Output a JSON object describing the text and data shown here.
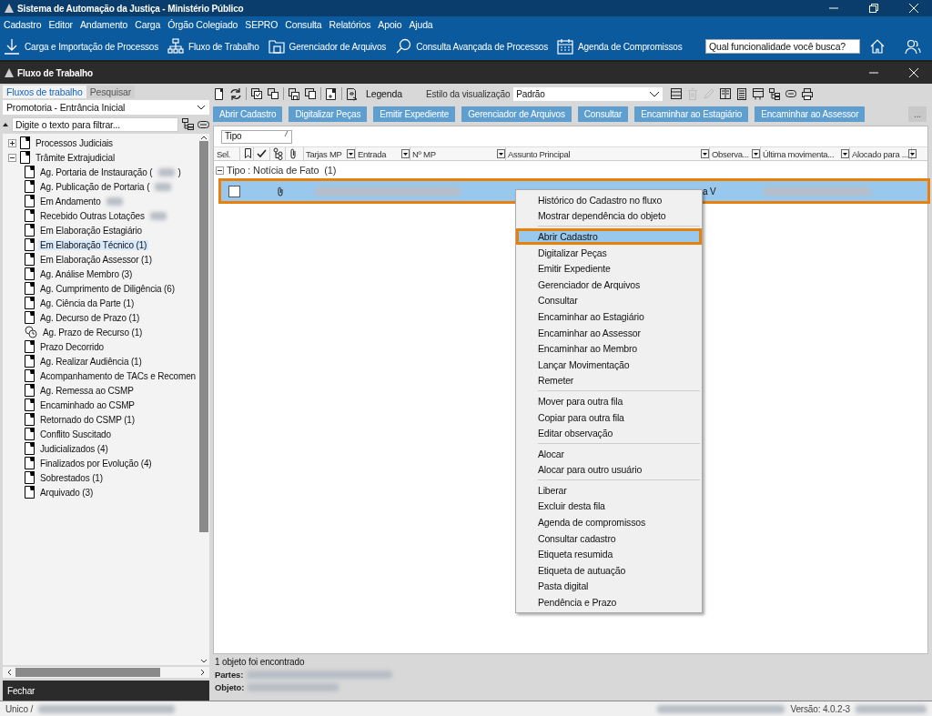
{
  "window": {
    "title": "Sistema de Automação da Justiça - Ministério Público"
  },
  "menu": [
    "Cadastro",
    "Editor",
    "Andamento",
    "Carga",
    "Órgão Colegiado",
    "SEPRO",
    "Consulta",
    "Relatórios",
    "Apoio",
    "Ajuda"
  ],
  "toolbar": [
    "Carga e Importação de Processos",
    "Fluxo de Trabalho",
    "Gerenciador de Arquivos",
    "Consulta Avançada de Processos",
    "Agenda de Compromissos"
  ],
  "search": {
    "placeholder": "Qual funcionalidade você busca?"
  },
  "subwindow": {
    "title": "Fluxo de Trabalho"
  },
  "left_tabs": [
    {
      "label": "Fluxos de trabalho",
      "selected": true
    },
    {
      "label": "Pesquisar",
      "selected": false
    }
  ],
  "flow_select": {
    "value": "Promotoria - Entrância Inicial"
  },
  "filter": {
    "placeholder": "Digite o texto para filtrar..."
  },
  "tree": [
    {
      "label": "Processos Judiciais",
      "expanded": false
    },
    {
      "label": "Trâmite Extrajudicial",
      "expanded": true,
      "children": [
        {
          "label": "Ag. Portaria de Instauração (",
          "redacted": true,
          "suffix": ")",
          "selected": false,
          "kind": "queue"
        },
        {
          "label": "Ag. Publicação de Portaria (",
          "redacted": true,
          "selected": false,
          "kind": "queue"
        },
        {
          "label": "Em Andamento",
          "redacted": true,
          "selected": false,
          "kind": "queue"
        },
        {
          "label": "Recebido Outras Lotações",
          "redacted": true,
          "selected": false,
          "kind": "queue"
        },
        {
          "label": "Em Elaboração Estagiário",
          "selected": false,
          "kind": "queue"
        },
        {
          "label": "Em Elaboração Técnico (1)",
          "selected": true,
          "kind": "queue"
        },
        {
          "label": "Em Elaboração Assessor (1)",
          "selected": false,
          "kind": "queue"
        },
        {
          "label": "Ag. Análise Membro (3)",
          "selected": false,
          "kind": "queue"
        },
        {
          "label": "Ag. Cumprimento de Diligência (6)",
          "selected": false,
          "kind": "queue"
        },
        {
          "label": "Ag. Ciência da Parte (1)",
          "selected": false,
          "kind": "queue"
        },
        {
          "label": "Ag. Decurso de Prazo (1)",
          "selected": false,
          "kind": "queue"
        },
        {
          "label": "Ag. Prazo de Recurso (1)",
          "selected": false,
          "kind": "timer"
        },
        {
          "label": "Prazo Decorrido",
          "selected": false,
          "kind": "queue"
        },
        {
          "label": "Ag. Realizar Audiência (1)",
          "selected": false,
          "kind": "queue"
        },
        {
          "label": "Acompanhamento de TACs e Recomen",
          "selected": false,
          "kind": "queue"
        },
        {
          "label": "Ag. Remessa ao CSMP",
          "selected": false,
          "kind": "queue"
        },
        {
          "label": "Encaminhado ao CSMP",
          "selected": false,
          "kind": "queue"
        },
        {
          "label": "Retornado do CSMP (1)",
          "selected": false,
          "kind": "queue"
        },
        {
          "label": "Conflito Suscitado",
          "selected": false,
          "kind": "queue"
        },
        {
          "label": "Judicializados (4)",
          "selected": false,
          "kind": "queue"
        },
        {
          "label": "Finalizados por Evolução (4)",
          "selected": false,
          "kind": "queue"
        },
        {
          "label": "Sobrestados (1)",
          "selected": false,
          "kind": "queue"
        },
        {
          "label": "Arquivado (3)",
          "selected": false,
          "kind": "queue"
        }
      ]
    }
  ],
  "close_button": "Fechar",
  "legend": "Legenda",
  "view_style": {
    "label": "Estilo da visualização",
    "value": "Padrão"
  },
  "view_tools": [
    {
      "disabled": false
    },
    {
      "disabled": true
    },
    {
      "disabled": true
    },
    {
      "disabled": false
    },
    {
      "disabled": false
    },
    {
      "disabled": false
    },
    {
      "disabled": false
    },
    {
      "disabled": false
    },
    {
      "disabled": false
    }
  ],
  "actions": [
    "Abrir Cadastro",
    "Digitalizar Peças",
    "Emitir Expediente",
    "Gerenciador de Arquivos",
    "Consultar",
    "Encaminhar ao Estagiário",
    "Encaminhar ao Assessor"
  ],
  "more_button": "...",
  "group_by": [
    "Tipo"
  ],
  "columns": [
    {
      "kind": "text",
      "label": "Sel."
    },
    {
      "kind": "icon"
    },
    {
      "kind": "icon"
    },
    {
      "kind": "icon"
    },
    {
      "kind": "icon"
    },
    {
      "kind": "text",
      "label": "Tarjas MP",
      "filter": true
    },
    {
      "kind": "text",
      "label": "Entrada",
      "filter": true
    },
    {
      "kind": "text",
      "label": "Nº MP",
      "filter": true
    },
    {
      "kind": "text",
      "label": "Assunto Principal",
      "filter": true
    },
    {
      "kind": "text",
      "label": "Observa...",
      "filter": true
    },
    {
      "kind": "text",
      "label": "Última movimenta...",
      "filter": true
    },
    {
      "kind": "text",
      "label": "Alocado para ...",
      "filter": true
    }
  ],
  "group": {
    "label": "Tipo : Notícia de Fato",
    "count": "(1)",
    "expanded": true
  },
  "rows": [
    {
      "checked": false,
      "selected": true,
      "annotated": true,
      "attachment": true,
      "subject": "a V"
    }
  ],
  "context_menu": {
    "sections": [
      [
        {
          "label": "Histórico do Cadastro no fluxo",
          "selected": false
        },
        {
          "label": "Mostrar dependência do objeto",
          "selected": false
        }
      ],
      [
        {
          "label": "Abrir Cadastro",
          "selected": true
        },
        {
          "label": "Digitalizar Peças",
          "selected": false
        },
        {
          "label": "Emitir Expediente",
          "selected": false
        },
        {
          "label": "Gerenciador de Arquivos",
          "selected": false
        },
        {
          "label": "Consultar",
          "selected": false
        },
        {
          "label": "Encaminhar ao Estagiário",
          "selected": false
        },
        {
          "label": "Encaminhar ao Assessor",
          "selected": false
        },
        {
          "label": "Encaminhar ao Membro",
          "selected": false
        },
        {
          "label": "Lançar Movimentação",
          "selected": false
        },
        {
          "label": "Remeter",
          "selected": false
        }
      ],
      [
        {
          "label": "Mover para outra fila",
          "selected": false
        },
        {
          "label": "Copiar para outra fila",
          "selected": false
        },
        {
          "label": "Editar observação",
          "selected": false
        }
      ],
      [
        {
          "label": "Alocar",
          "selected": false
        },
        {
          "label": "Alocar para outro usuário",
          "selected": false
        }
      ],
      [
        {
          "label": "Liberar",
          "selected": false
        },
        {
          "label": "Excluir desta fila",
          "selected": false
        },
        {
          "label": "Agenda de compromissos",
          "selected": false
        },
        {
          "label": "Consultar cadastro",
          "selected": false
        },
        {
          "label": "Etiqueta resumida",
          "selected": false
        },
        {
          "label": "Etiqueta de autuação",
          "selected": false
        },
        {
          "label": "Pasta digital",
          "selected": false
        },
        {
          "label": "Pendência e Prazo",
          "selected": false
        }
      ]
    ]
  },
  "details": {
    "found": "1 objeto foi encontrado",
    "parties_label": "Partes:",
    "object_label": "Objeto:"
  },
  "status_bar": {
    "left": "Unico /",
    "version": "Versão: 4.0.2-3"
  }
}
